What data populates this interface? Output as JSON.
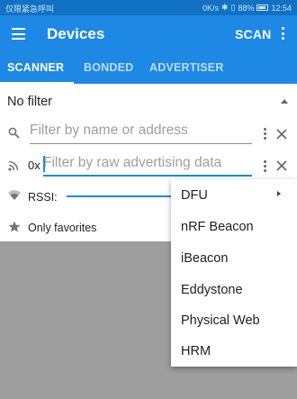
{
  "status_bar": {
    "carrier": "仅限紧急呼叫",
    "network": "0K/s",
    "battery_text": "88%",
    "battery_level": 0.88,
    "time": "12:54"
  },
  "app_bar": {
    "title": "Devices",
    "scan_label": "SCAN"
  },
  "tabs": [
    {
      "label": "SCANNER",
      "active": true
    },
    {
      "label": "BONDED",
      "active": false
    },
    {
      "label": "ADVERTISER",
      "active": false
    }
  ],
  "filter": {
    "title": "No filter",
    "name_placeholder": "Filter by name or address",
    "raw_prefix": "0x",
    "raw_placeholder": "Filter by raw advertising data",
    "rssi_label": "RSSI:",
    "favorites_label": "Only favorites"
  },
  "menu": {
    "items": [
      "DFU",
      "nRF Beacon",
      "iBeacon",
      "Eddystone",
      "Physical Web",
      "HRM"
    ]
  },
  "colors": {
    "primary": "#1e88e5",
    "status_bar": "#1172c4",
    "dim_background": "#9e9e9e"
  }
}
